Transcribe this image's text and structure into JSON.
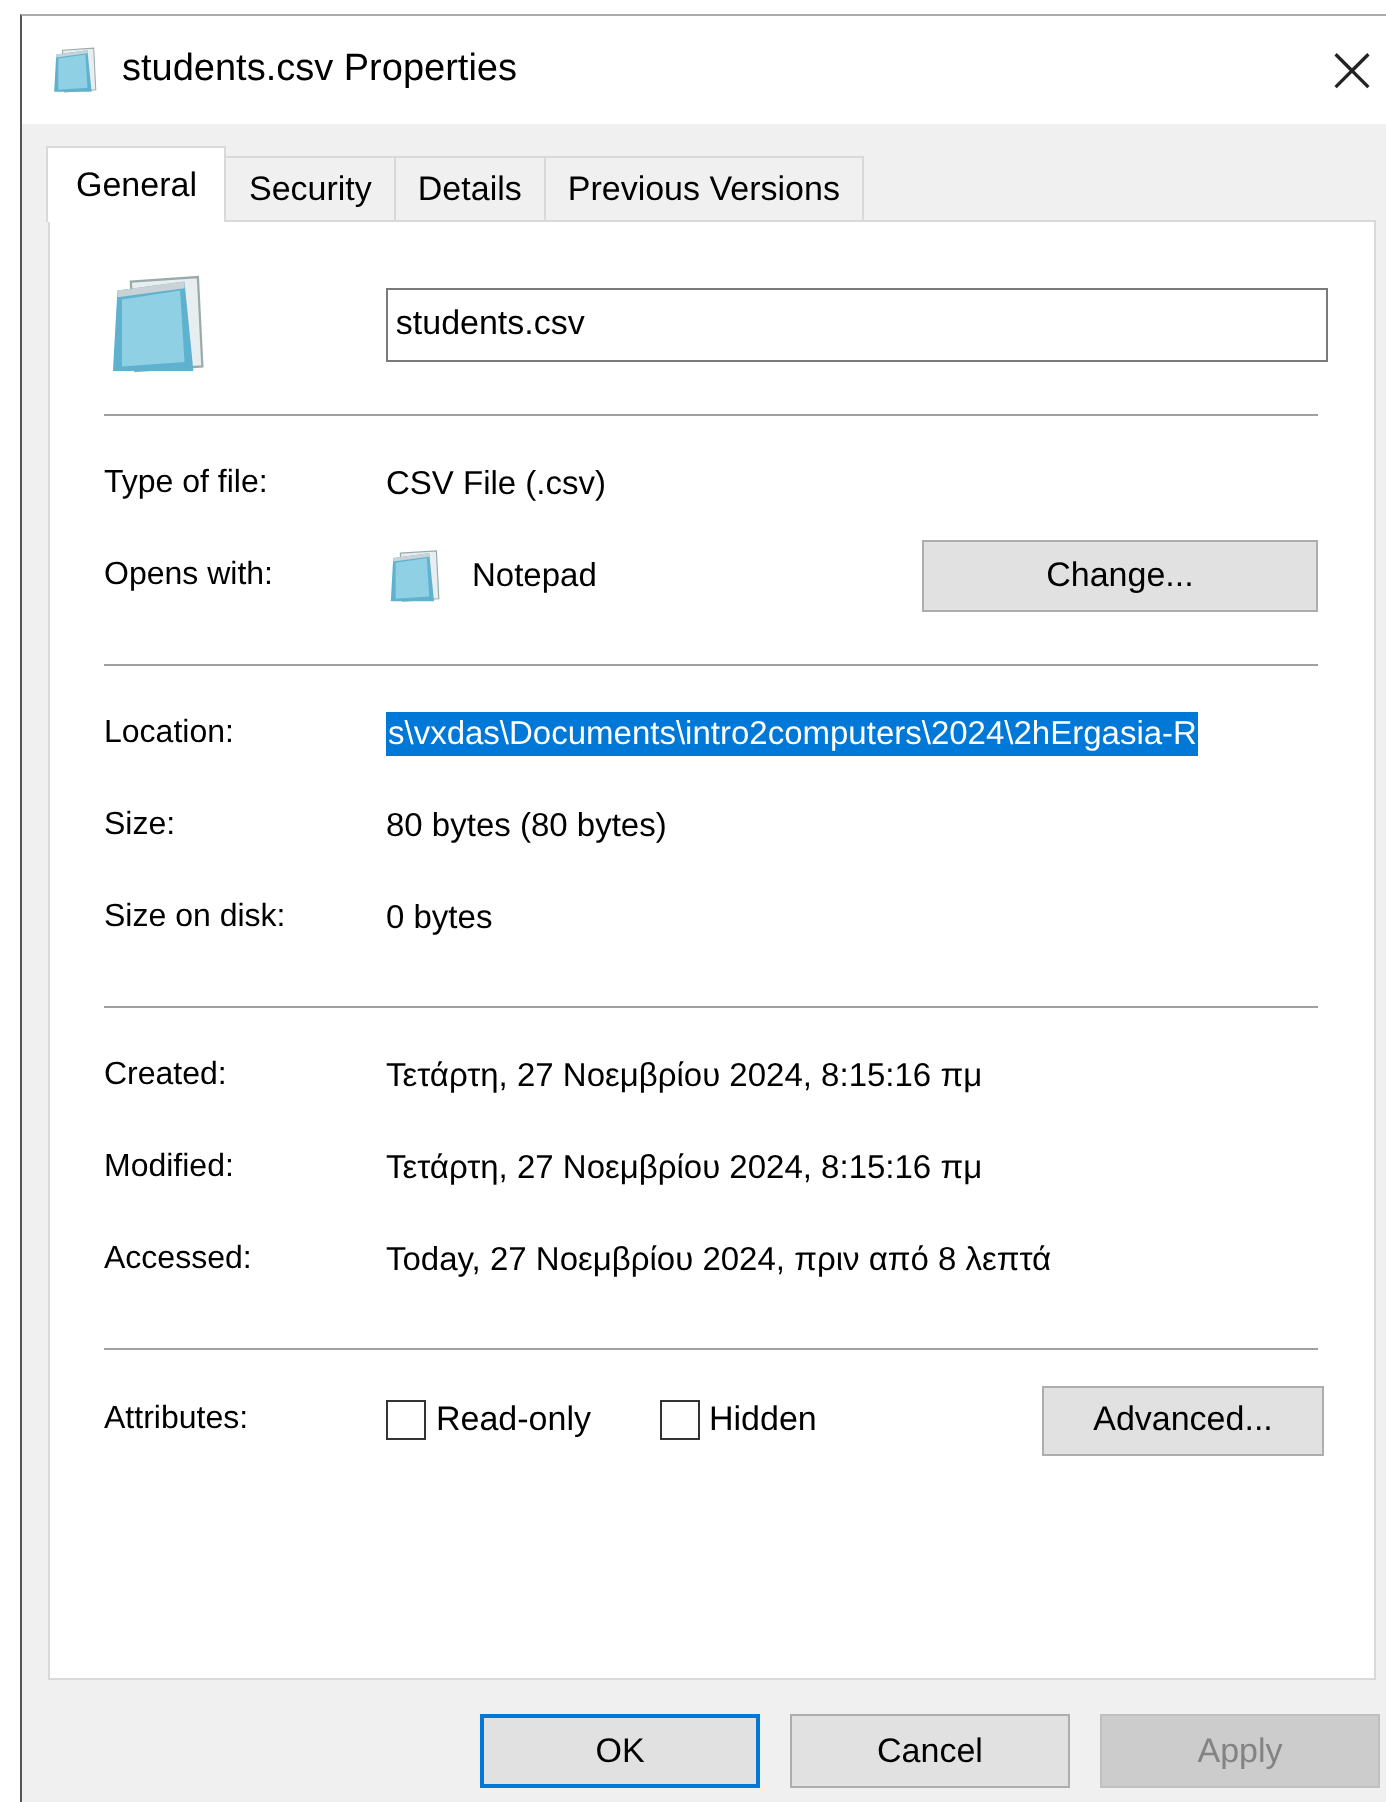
{
  "window": {
    "title": "students.csv Properties",
    "close": "×"
  },
  "tabs": [
    {
      "label": "General",
      "selected": true
    },
    {
      "label": "Security",
      "selected": false
    },
    {
      "label": "Details",
      "selected": false
    },
    {
      "label": "Previous Versions",
      "selected": false
    }
  ],
  "name_field": {
    "value": "students.csv"
  },
  "sections": [
    [
      {
        "kind": "text",
        "label": "Type of file:",
        "value": "CSV File (.csv)"
      },
      {
        "kind": "app",
        "label": "Opens with:",
        "value": "Notepad",
        "button": "Change..."
      }
    ],
    [
      {
        "kind": "selected_text",
        "label": "Location:",
        "value": "s\\vxdas\\Documents\\intro2computers\\2024\\2hErgasia-R"
      },
      {
        "kind": "text",
        "label": "Size:",
        "value": "80 bytes (80 bytes)"
      },
      {
        "kind": "text",
        "label": "Size on disk:",
        "value": "0 bytes"
      }
    ],
    [
      {
        "kind": "text",
        "label": "Created:",
        "value": "Τετάρτη, 27 Νοεμβρίου 2024, 8:15:16 πμ"
      },
      {
        "kind": "text",
        "label": "Modified:",
        "value": "Τετάρτη, 27 Νοεμβρίου 2024, 8:15:16 πμ"
      },
      {
        "kind": "text",
        "label": "Accessed:",
        "value": "Today, 27 Νοεμβρίου 2024, πριν από 8 λεπτά"
      }
    ]
  ],
  "attributes": {
    "label": "Attributes:",
    "checkboxes": [
      {
        "label": "Read-only",
        "checked": false
      },
      {
        "label": "Hidden",
        "checked": false
      }
    ],
    "button": "Advanced..."
  },
  "buttons": [
    {
      "label": "OK",
      "default": true,
      "disabled": false
    },
    {
      "label": "Cancel",
      "default": false,
      "disabled": false
    },
    {
      "label": "Apply",
      "default": false,
      "disabled": true
    }
  ]
}
